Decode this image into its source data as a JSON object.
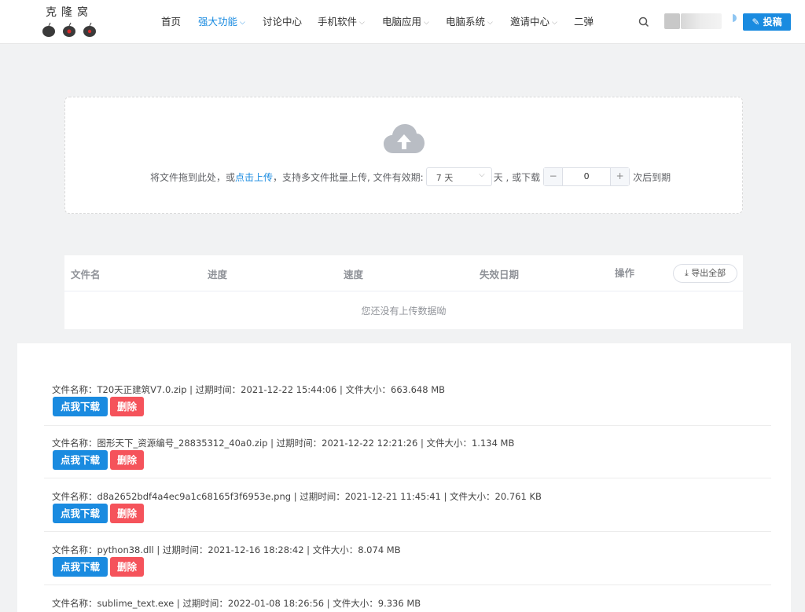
{
  "header": {
    "logo_text": "克隆窝",
    "nav": [
      {
        "label": "首页",
        "dropdown": false,
        "active": false
      },
      {
        "label": "强大功能",
        "dropdown": true,
        "active": true
      },
      {
        "label": "讨论中心",
        "dropdown": false,
        "active": false
      },
      {
        "label": "手机软件",
        "dropdown": true,
        "active": false
      },
      {
        "label": "电脑应用",
        "dropdown": true,
        "active": false
      },
      {
        "label": "电脑系统",
        "dropdown": true,
        "active": false
      },
      {
        "label": "邀请中心",
        "dropdown": true,
        "active": false
      },
      {
        "label": "二弹",
        "dropdown": false,
        "active": false
      }
    ],
    "search_icon": "search-icon",
    "contribute_label": "投稿",
    "contribute_icon": "edit-icon"
  },
  "upload": {
    "text_before": "将文件拖到此处，或",
    "link": "点击上传",
    "text_after": "，支持多文件批量上传, 文件有效期:",
    "days_value": "7 天",
    "days_suffix": "天 , 或下载",
    "downloads_value": "0",
    "minus": "−",
    "plus": "+",
    "suffix": "次后到期",
    "icon": "cloud-upload-icon"
  },
  "table": {
    "columns": [
      "文件名",
      "进度",
      "速度",
      "失效日期",
      "操作"
    ],
    "export_label": "导出全部",
    "empty_text": "您还没有上传数据呦"
  },
  "files": [
    {
      "info": "文件名称：T20天正建筑V7.0.zip | 过期时间：2021-12-22 15:44:06 | 文件大小：663.648 MB"
    },
    {
      "info": "文件名称：图形天下_资源编号_28835312_40a0.zip | 过期时间：2021-12-22 12:21:26 | 文件大小：1.134 MB"
    },
    {
      "info": "文件名称：d8a2652bdf4a4ec9a1c68165f3f6953e.png | 过期时间：2021-12-21 11:45:41 | 文件大小：20.761 KB"
    },
    {
      "info": "文件名称：python38.dll | 过期时间：2021-12-16 18:28:42 | 文件大小：8.074 MB"
    },
    {
      "info": "文件名称：sublime_text.exe | 过期时间：2022-01-08 18:26:56 | 文件大小：9.336 MB"
    }
  ],
  "file_actions": {
    "download": "点我下载",
    "delete": "删除"
  },
  "colors": {
    "accent": "#1a8be0",
    "danger": "#f5535b",
    "background": "#f1f2f3"
  }
}
